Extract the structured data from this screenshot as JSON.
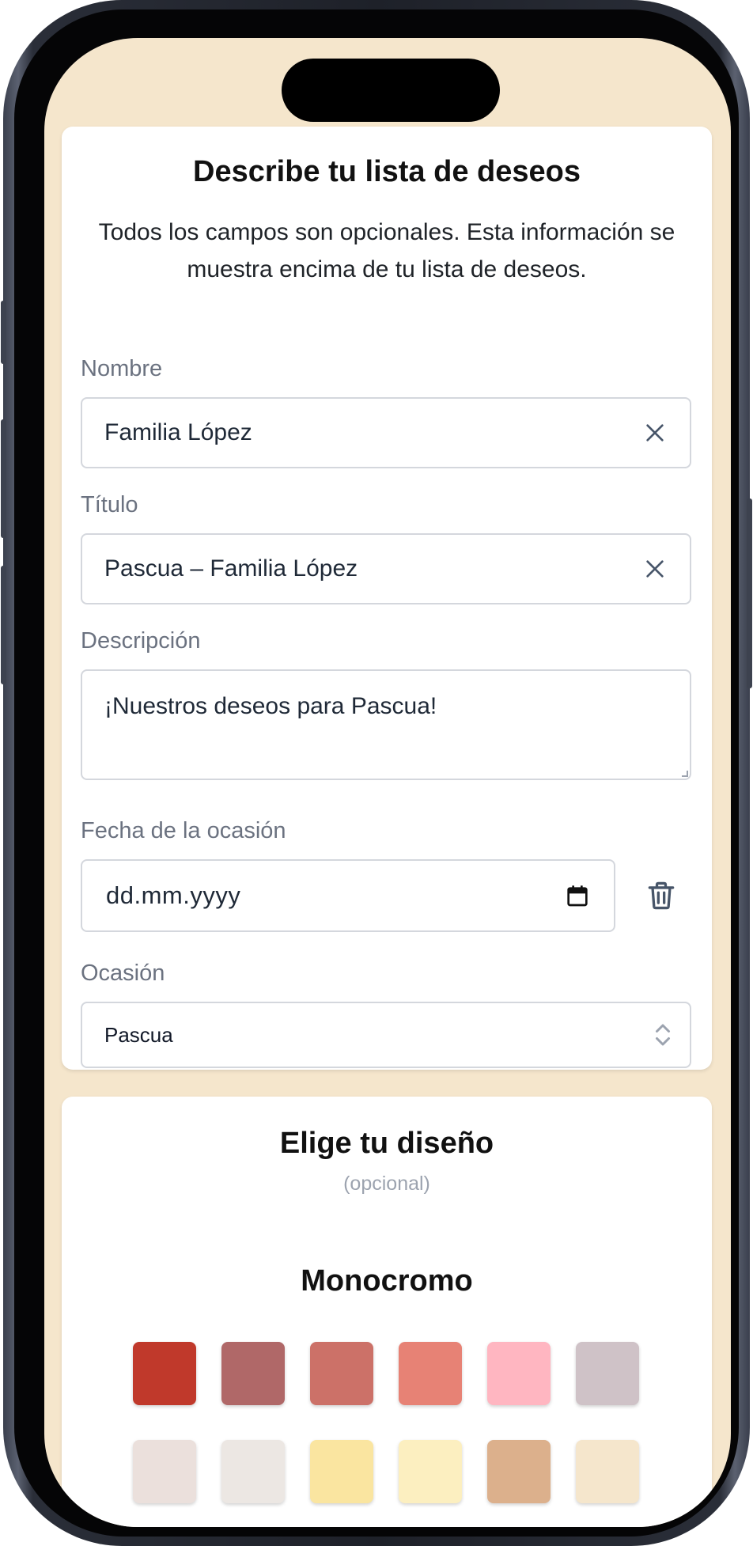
{
  "form": {
    "title": "Describe tu lista de deseos",
    "intro": "Todos los campos son opcionales. Esta información se muestra encima de tu lista de deseos.",
    "name_label": "Nombre",
    "name_value": "Familia López",
    "title_label": "Título",
    "title_value": "Pascua – Familia López",
    "description_label": "Descripción",
    "description_value": "¡Nuestros deseos para Pascua!",
    "date_label": "Fecha de la ocasión",
    "date_placeholder": "dd.mm.yyyy",
    "occasion_label": "Ocasión",
    "occasion_value": "Pascua"
  },
  "design": {
    "title": "Elige tu diseño",
    "subtitle": "(opcional)",
    "section_title": "Monocromo",
    "swatches_row1": [
      "#c0392b",
      "#b06868",
      "#cc7168",
      "#e78275",
      "#ffb6c1",
      "#cfc2c7"
    ],
    "swatches_row2": [
      "#ebe0dc",
      "#ece7e3",
      "#fae5a0",
      "#fcefc0",
      "#dcb08c",
      "#f5e6cc"
    ]
  },
  "colors": {
    "background": "#f5e6cc",
    "card": "#ffffff",
    "label": "#6b7280",
    "icon": "#475569"
  }
}
